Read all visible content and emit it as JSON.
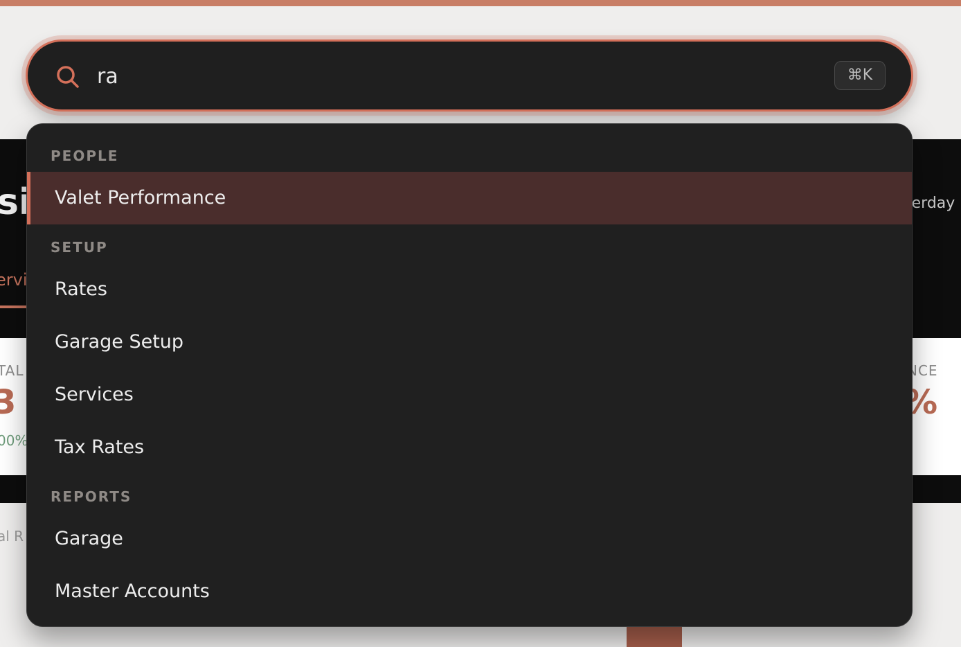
{
  "search": {
    "value": "ra",
    "shortcut": "⌘K"
  },
  "palette": {
    "sections": [
      {
        "label": "PEOPLE",
        "items": [
          "Valet Performance"
        ]
      },
      {
        "label": "SETUP",
        "items": [
          "Rates",
          "Garage Setup",
          "Services",
          "Tax Rates"
        ]
      },
      {
        "label": "REPORTS",
        "items": [
          "Garage",
          "Master Accounts"
        ]
      }
    ],
    "active_item": "Valet Performance"
  },
  "background": {
    "heading_fragment": "si",
    "tab_fragment": "ervi",
    "right_top_fragment": "terday",
    "left_label_fragment": "TAL",
    "left_value_fragment": "3",
    "left_pct_fragment": "00%",
    "right_label_fragment": "NCE",
    "right_value_fragment": "%",
    "left_bottom_fragment": "al R"
  },
  "colors": {
    "accent": "#d4705a",
    "active_row": "#4a2d2c",
    "palette_bg": "#202020"
  },
  "icons": {
    "search": "search-icon"
  }
}
